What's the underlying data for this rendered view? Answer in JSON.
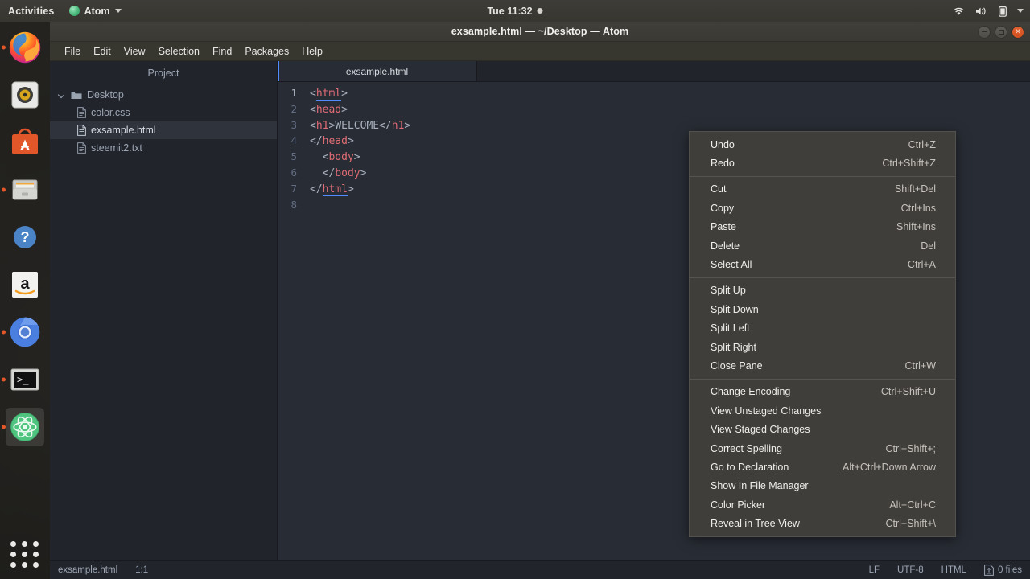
{
  "topbar": {
    "activities": "Activities",
    "app_name": "Atom",
    "clock": "Tue 11:32",
    "icons": [
      "wifi-icon",
      "volume-icon",
      "battery-icon",
      "chevron-down-icon"
    ]
  },
  "dock": {
    "items": [
      {
        "name": "firefox",
        "label": "Firefox",
        "running": true,
        "active": false
      },
      {
        "name": "rhythmbox",
        "label": "Rhythmbox",
        "running": false,
        "active": false
      },
      {
        "name": "ubuntu-software",
        "label": "Ubuntu Software",
        "running": false,
        "active": false
      },
      {
        "name": "files",
        "label": "Files",
        "running": true,
        "active": false
      },
      {
        "name": "help",
        "label": "Help",
        "running": false,
        "active": false
      },
      {
        "name": "amazon",
        "label": "Amazon",
        "running": false,
        "active": false
      },
      {
        "name": "chromium",
        "label": "Chromium",
        "running": true,
        "active": false
      },
      {
        "name": "terminal",
        "label": "Terminal",
        "running": true,
        "active": false
      },
      {
        "name": "atom",
        "label": "Atom",
        "running": true,
        "active": true
      }
    ],
    "show_apps_label": "Show Applications"
  },
  "window": {
    "title": "exsample.html — ~/Desktop — Atom",
    "controls": {
      "minimize": "minimize-button",
      "maximize": "maximize-button",
      "close": "close-button"
    }
  },
  "menubar": {
    "items": [
      "File",
      "Edit",
      "View",
      "Selection",
      "Find",
      "Packages",
      "Help"
    ]
  },
  "treeview": {
    "header": "Project",
    "root": {
      "label": "Desktop",
      "expanded": true
    },
    "files": [
      {
        "label": "color.css",
        "selected": false
      },
      {
        "label": "exsample.html",
        "selected": true
      },
      {
        "label": "steemit2.txt",
        "selected": false
      }
    ]
  },
  "tabs": [
    {
      "label": "exsample.html",
      "active": true
    }
  ],
  "editor": {
    "lines": [
      {
        "num": "1",
        "tokens": [
          {
            "t": "<",
            "c": "punc"
          },
          {
            "t": "html",
            "c": "tag-u"
          },
          {
            "t": ">",
            "c": "punc"
          }
        ]
      },
      {
        "num": "2",
        "tokens": [
          {
            "t": "<",
            "c": "punc"
          },
          {
            "t": "head",
            "c": "tag"
          },
          {
            "t": ">",
            "c": "punc"
          }
        ]
      },
      {
        "num": "3",
        "tokens": [
          {
            "t": "<",
            "c": "punc"
          },
          {
            "t": "h1",
            "c": "tag"
          },
          {
            "t": ">",
            "c": "punc"
          },
          {
            "t": "WELCOME",
            "c": "text"
          },
          {
            "t": "</",
            "c": "punc"
          },
          {
            "t": "h1",
            "c": "tag"
          },
          {
            "t": ">",
            "c": "punc"
          }
        ]
      },
      {
        "num": "4",
        "tokens": [
          {
            "t": "</",
            "c": "punc"
          },
          {
            "t": "head",
            "c": "tag"
          },
          {
            "t": ">",
            "c": "punc"
          }
        ]
      },
      {
        "num": "5",
        "tokens": [
          {
            "t": "  <",
            "c": "punc"
          },
          {
            "t": "body",
            "c": "tag"
          },
          {
            "t": ">",
            "c": "punc"
          }
        ]
      },
      {
        "num": "6",
        "tokens": [
          {
            "t": "  </",
            "c": "punc"
          },
          {
            "t": "body",
            "c": "tag"
          },
          {
            "t": ">",
            "c": "punc"
          }
        ]
      },
      {
        "num": "7",
        "tokens": [
          {
            "t": "</",
            "c": "punc"
          },
          {
            "t": "html",
            "c": "tag-u"
          },
          {
            "t": ">",
            "c": "punc"
          }
        ]
      },
      {
        "num": "8",
        "tokens": []
      }
    ]
  },
  "statusbar": {
    "filename": "exsample.html",
    "cursor": "1:1",
    "line_ending": "LF",
    "encoding": "UTF-8",
    "grammar": "HTML",
    "git_files": "0 files"
  },
  "context_menu": {
    "groups": [
      [
        {
          "label": "Undo",
          "accel": "Ctrl+Z"
        },
        {
          "label": "Redo",
          "accel": "Ctrl+Shift+Z"
        }
      ],
      [
        {
          "label": "Cut",
          "accel": "Shift+Del"
        },
        {
          "label": "Copy",
          "accel": "Ctrl+Ins"
        },
        {
          "label": "Paste",
          "accel": "Shift+Ins"
        },
        {
          "label": "Delete",
          "accel": "Del"
        },
        {
          "label": "Select All",
          "accel": "Ctrl+A"
        }
      ],
      [
        {
          "label": "Split Up",
          "accel": ""
        },
        {
          "label": "Split Down",
          "accel": ""
        },
        {
          "label": "Split Left",
          "accel": ""
        },
        {
          "label": "Split Right",
          "accel": ""
        },
        {
          "label": "Close Pane",
          "accel": "Ctrl+W"
        }
      ],
      [
        {
          "label": "Change Encoding",
          "accel": "Ctrl+Shift+U"
        },
        {
          "label": "View Unstaged Changes",
          "accel": ""
        },
        {
          "label": "View Staged Changes",
          "accel": ""
        },
        {
          "label": "Correct Spelling",
          "accel": "Ctrl+Shift+;"
        },
        {
          "label": "Go to Declaration",
          "accel": "Alt+Ctrl+Down Arrow"
        },
        {
          "label": "Show In File Manager",
          "accel": ""
        },
        {
          "label": "Color Picker",
          "accel": "Alt+Ctrl+C"
        },
        {
          "label": "Reveal in Tree View",
          "accel": "Ctrl+Shift+\\"
        }
      ]
    ]
  },
  "colors": {
    "editor_bg": "#282c34",
    "sidebar_bg": "#21252b",
    "accent": "#528bff",
    "tag": "#e06c75",
    "menu_bg": "#403e3a",
    "ubuntu_orange": "#e2572a"
  }
}
